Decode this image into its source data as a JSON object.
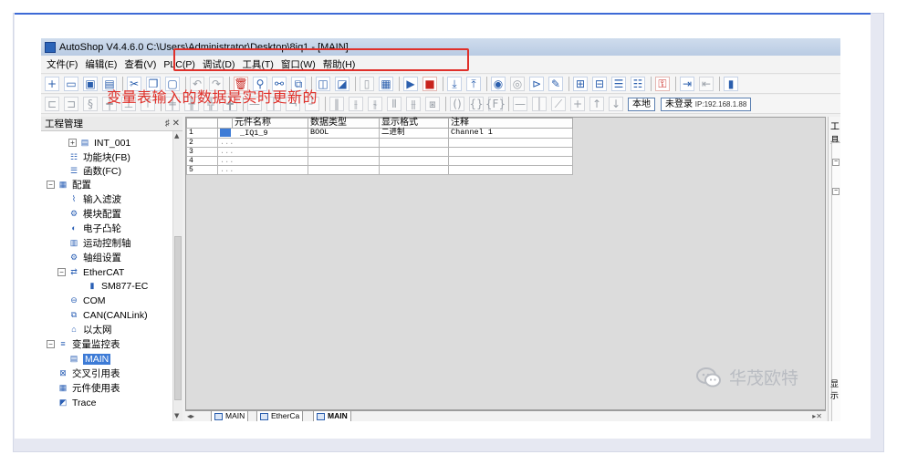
{
  "window": {
    "title": "AutoShop V4.4.6.0  C:\\Users\\Administrator\\Desktop\\8iq1 - [MAIN]"
  },
  "menu": [
    "文件(F)",
    "编辑(E)",
    "查看(V)",
    "PLC(P)",
    "调试(D)",
    "工具(T)",
    "窗口(W)",
    "帮助(H)"
  ],
  "toolbar2": {
    "local_label": "本地",
    "login_label": "未登录",
    "ip_label": "IP:192.168.1.88"
  },
  "project_panel": {
    "title": "工程管理",
    "pin": "♯ ✕",
    "items": [
      {
        "label": "INT_001",
        "icon": "table-icon"
      },
      {
        "label": "功能块(FB)",
        "icon": "function-block-icon"
      },
      {
        "label": "函数(FC)",
        "icon": "function-icon"
      },
      {
        "label": "配置",
        "icon": "config-folder-icon"
      },
      {
        "label": "输入滤波",
        "icon": "input-filter-icon"
      },
      {
        "label": "模块配置",
        "icon": "module-config-icon"
      },
      {
        "label": "电子凸轮",
        "icon": "electronic-cam-icon"
      },
      {
        "label": "运动控制轴",
        "icon": "motion-axis-icon"
      },
      {
        "label": "轴组设置",
        "icon": "axis-group-icon"
      },
      {
        "label": "EtherCAT",
        "icon": "ethercat-icon"
      },
      {
        "label": "SM877-EC",
        "icon": "device-icon"
      },
      {
        "label": "COM",
        "icon": "com-port-icon"
      },
      {
        "label": "CAN(CANLink)",
        "icon": "can-network-icon"
      },
      {
        "label": "以太网",
        "icon": "ethernet-icon"
      },
      {
        "label": "变量监控表",
        "icon": "monitor-folder-icon"
      },
      {
        "label": "MAIN",
        "icon": "table-icon"
      },
      {
        "label": "交叉引用表",
        "icon": "cross-reference-icon"
      },
      {
        "label": "元件使用表",
        "icon": "element-usage-icon"
      },
      {
        "label": "Trace",
        "icon": "trace-icon"
      }
    ]
  },
  "grid": {
    "headers": [
      "元件名称",
      "数据类型",
      "显示格式",
      "注释"
    ],
    "rows": [
      {
        "num": "1",
        "name": "_IQ1_9",
        "type": "BOOL",
        "format": "二进制",
        "comment": "Channel 1"
      },
      {
        "num": "2",
        "name": "...",
        "type": "",
        "format": "",
        "comment": ""
      },
      {
        "num": "3",
        "name": "...",
        "type": "",
        "format": "",
        "comment": ""
      },
      {
        "num": "4",
        "name": "...",
        "type": "",
        "format": "",
        "comment": ""
      },
      {
        "num": "5",
        "name": "...",
        "type": "",
        "format": "",
        "comment": ""
      }
    ]
  },
  "annotation": "变量表输入的数据是实时更新的",
  "tabs": [
    {
      "label": "MAIN"
    },
    {
      "label": "EtherCa"
    },
    {
      "label": "MAIN"
    }
  ],
  "right_panel": {
    "title": "工具",
    "bottom": "显示"
  },
  "watermark": "华茂欧特",
  "colors": {
    "accent": "#3d7bd6",
    "annotation": "#e0302a",
    "frame": "#e6e8f2"
  }
}
